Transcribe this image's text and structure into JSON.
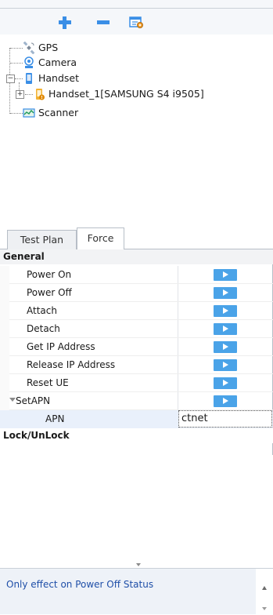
{
  "toolbar": {
    "buttons": [
      {
        "name": "add",
        "icon": "plus-icon"
      },
      {
        "name": "remove",
        "icon": "minus-icon"
      },
      {
        "name": "configure",
        "icon": "device-config-icon"
      }
    ]
  },
  "tree": {
    "items": [
      {
        "label": "GPS",
        "icon": "satellite-icon"
      },
      {
        "label": "Camera",
        "icon": "camera-icon"
      },
      {
        "label": "Handset",
        "icon": "handset-icon",
        "expanded": true
      },
      {
        "label": "Handset_1[SAMSUNG S4 i9505]",
        "icon": "phone-warning-icon"
      },
      {
        "label": "Scanner",
        "icon": "scanner-icon"
      }
    ]
  },
  "tabs": [
    {
      "label": "Test Plan",
      "active": false
    },
    {
      "label": "Force",
      "active": true
    }
  ],
  "grid": {
    "categories": {
      "general": "General",
      "lock": "Lock/UnLock"
    },
    "actions": [
      {
        "label": "Power On"
      },
      {
        "label": "Power Off"
      },
      {
        "label": "Attach"
      },
      {
        "label": "Detach"
      },
      {
        "label": "Get IP Address"
      },
      {
        "label": "Release IP Address"
      },
      {
        "label": "Reset UE"
      },
      {
        "label": "SetAPN"
      }
    ],
    "apn": {
      "label": "APN",
      "value": "ctnet"
    }
  },
  "description": {
    "text": "Only effect on Power Off Status"
  },
  "colors": {
    "accent": "#4aa3e8",
    "description_text": "#1f4fa8"
  }
}
